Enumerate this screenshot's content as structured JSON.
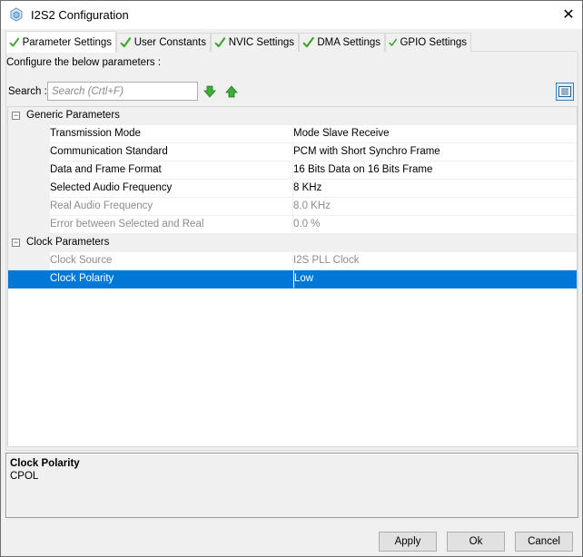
{
  "window": {
    "title": "I2S2 Configuration",
    "close_glyph": "✕"
  },
  "tabs": [
    {
      "label": "Parameter Settings",
      "active": true
    },
    {
      "label": "User Constants",
      "active": false
    },
    {
      "label": "NVIC Settings",
      "active": false
    },
    {
      "label": "DMA Settings",
      "active": false
    },
    {
      "label": "GPIO Settings",
      "active": false
    }
  ],
  "panel": {
    "configure_label": "Configure the below parameters :",
    "search_label": "Search :",
    "search_placeholder": "Search (Crtl+F)",
    "search_value": ""
  },
  "groups": [
    {
      "label": "Generic Parameters",
      "toggle": "⊟",
      "rows": [
        {
          "name": "Transmission Mode",
          "value": "Mode Slave Receive",
          "disabled": false,
          "selected": false
        },
        {
          "name": "Communication Standard",
          "value": "PCM with Short Synchro Frame",
          "disabled": false,
          "selected": false
        },
        {
          "name": "Data and Frame Format",
          "value": "16 Bits Data on 16 Bits Frame",
          "disabled": false,
          "selected": false
        },
        {
          "name": "Selected Audio Frequency",
          "value": "8 KHz",
          "disabled": false,
          "selected": false
        },
        {
          "name": "Real Audio Frequency",
          "value": "8.0 KHz",
          "disabled": true,
          "selected": false
        },
        {
          "name": "Error between Selected and Real",
          "value": "0.0 %",
          "disabled": true,
          "selected": false
        }
      ]
    },
    {
      "label": "Clock Parameters",
      "toggle": "⊟",
      "rows": [
        {
          "name": "Clock Source",
          "value": "I2S PLL Clock",
          "disabled": true,
          "selected": false
        },
        {
          "name": "Clock Polarity",
          "value": "Low",
          "disabled": false,
          "selected": true
        }
      ]
    }
  ],
  "description": {
    "title": "Clock Polarity",
    "text": "CPOL"
  },
  "buttons": {
    "apply": "Apply",
    "ok": "Ok",
    "cancel": "Cancel"
  },
  "colors": {
    "selection": "#0078d7",
    "check_green": "#3aa52a",
    "arrow_green": "#3bb034"
  },
  "icons": {
    "tab_check": "check-icon",
    "down": "arrow-down-icon",
    "up": "arrow-up-icon",
    "view": "list-view-icon"
  }
}
